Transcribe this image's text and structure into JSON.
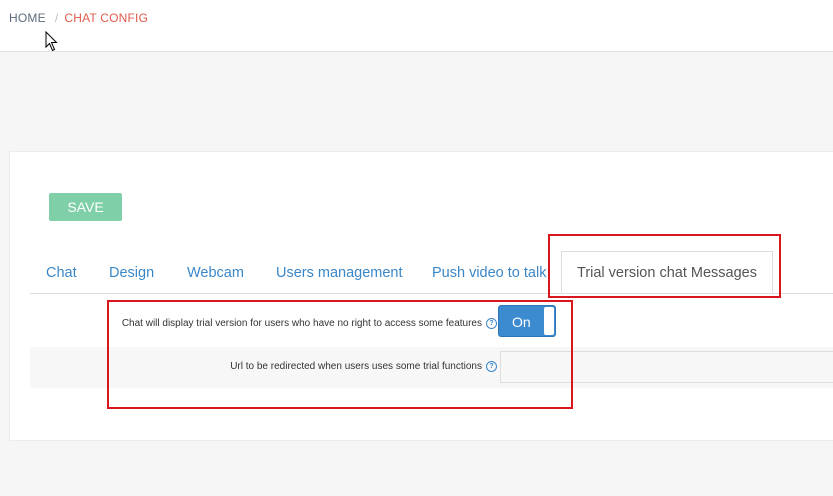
{
  "breadcrumb": {
    "home": "HOME",
    "separator": "/",
    "current": "CHAT CONFIG"
  },
  "toolbar": {
    "save_label": "SAVE"
  },
  "tabs": [
    {
      "label": "Chat"
    },
    {
      "label": "Design"
    },
    {
      "label": "Webcam"
    },
    {
      "label": "Users management"
    },
    {
      "label": "Push video to talk"
    },
    {
      "label": "Trial version chat Messages",
      "active": true
    }
  ],
  "form": {
    "trial_display": {
      "label": "Chat will display trial version for users who have no right to access some features",
      "toggle_value": "On",
      "help_icon": "question-circle-icon"
    },
    "redirect_url": {
      "label": "Url to be redirected when users uses some trial functions",
      "value": "",
      "help_icon": "question-circle-icon"
    }
  },
  "colors": {
    "accent": "#3a87c8",
    "breadcrumb_current": "#e25a4b",
    "save_button": "#7fcfa8",
    "toggle_on": "#3c8ad0",
    "highlight": "#d9161c"
  }
}
